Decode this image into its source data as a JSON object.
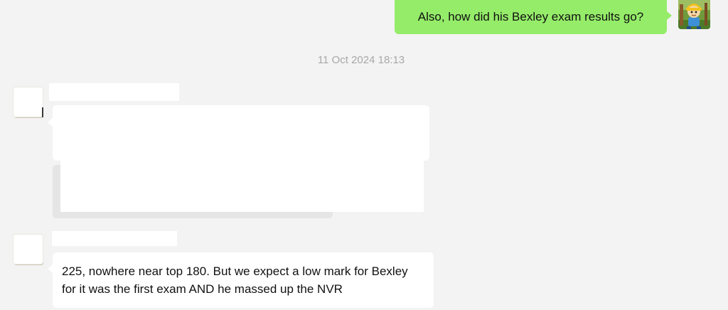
{
  "messages": {
    "outgoing": {
      "text": "Also, how did his Bexley exam results go?"
    },
    "timestamp": "11 Oct 2024 18:13",
    "incoming_reply": {
      "text": "225, nowhere near top 180. But we expect a low mark for Bexley for it was the first exam AND he massed up the NVR"
    }
  },
  "colors": {
    "background": "#f3f3f3",
    "outgoing_bubble": "#95ec69",
    "incoming_bubble": "#ffffff",
    "timestamp": "#a8a8a8"
  },
  "icons": {
    "my_avatar": "cartoon-avatar-icon",
    "contact_avatar": "avatar-placeholder"
  }
}
